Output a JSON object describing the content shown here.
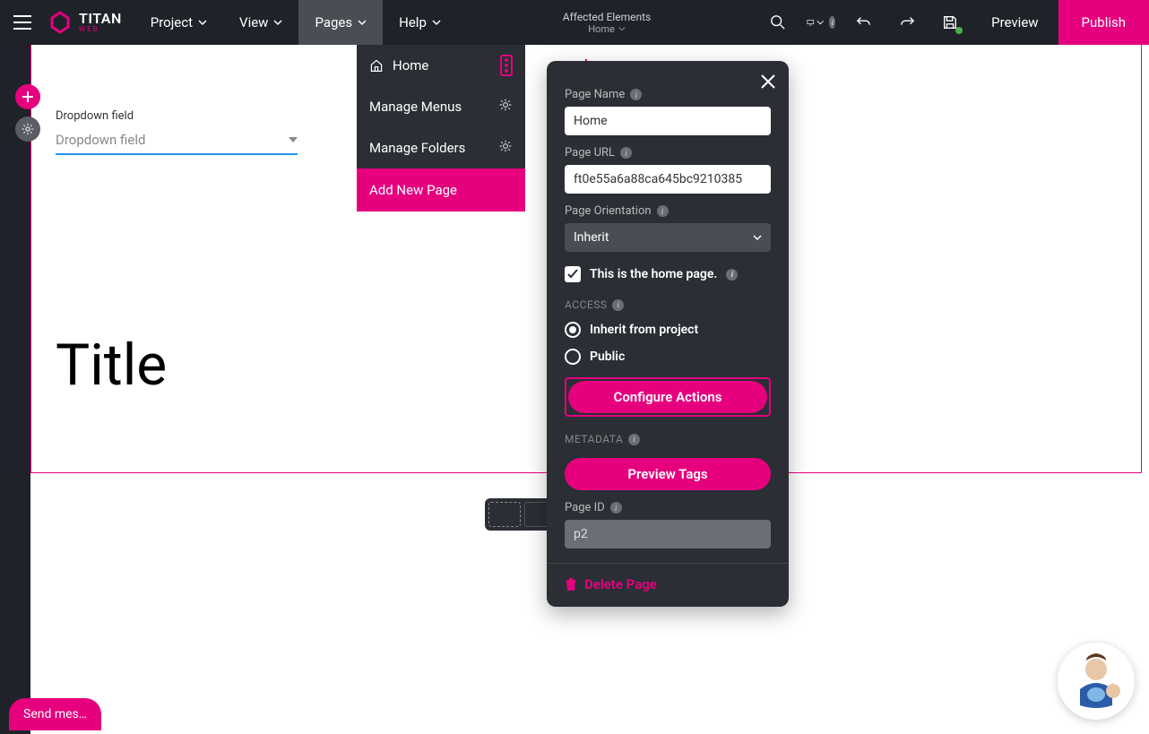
{
  "brand": {
    "name": "TITAN",
    "sub": "WEB"
  },
  "topMenu": {
    "project": "Project",
    "view": "View",
    "pages": "Pages",
    "help": "Help"
  },
  "affected": {
    "label": "Affected Elements",
    "page": "Home"
  },
  "actions": {
    "preview": "Preview",
    "publish": "Publish"
  },
  "pagesDropdown": {
    "home": "Home",
    "manageMenus": "Manage Menus",
    "manageFolders": "Manage Folders",
    "addNew": "Add New Page"
  },
  "canvas": {
    "dropdownLabel": "Dropdown field",
    "dropdownPlaceholder": "Dropdown field",
    "title": "Title"
  },
  "settings": {
    "pageNameLabel": "Page Name",
    "pageNameValue": "Home",
    "pageUrlLabel": "Page URL",
    "pageUrlValue": "ft0e55a6a88ca645bc9210385",
    "orientationLabel": "Page Orientation",
    "orientationValue": "Inherit",
    "homeCheck": "This is the home page.",
    "accessLabel": "ACCESS",
    "radioInherit": "Inherit from project",
    "radioPublic": "Public",
    "configureActions": "Configure Actions",
    "metadataLabel": "METADATA",
    "previewTags": "Preview Tags",
    "pageIdLabel": "Page ID",
    "pageIdValue": "p2",
    "deletePage": "Delete Page"
  },
  "sendMessage": "Send mes…"
}
